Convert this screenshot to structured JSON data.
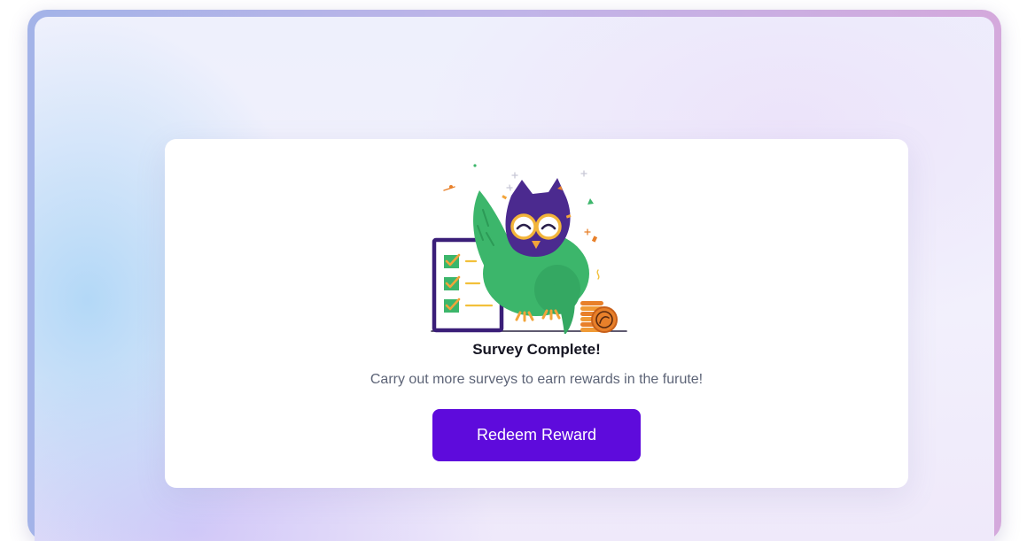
{
  "dialog": {
    "title": "Survey Complete!",
    "message": "Carry out more surveys to earn rewards in the furute!",
    "button_label": "Redeem Reward"
  },
  "illustration": {
    "subject": "owl-mascot-celebrating-survey",
    "icons": [
      "checklist-icon",
      "owl-mascot-icon",
      "coin-stack-icon",
      "confetti-icon"
    ]
  },
  "colors": {
    "accent": "#5e0bdc",
    "title_text": "#151522",
    "body_text": "#5d6477",
    "owl_body": "#3cb66b",
    "owl_head": "#4b2a8f",
    "coin": "#e8802a"
  }
}
